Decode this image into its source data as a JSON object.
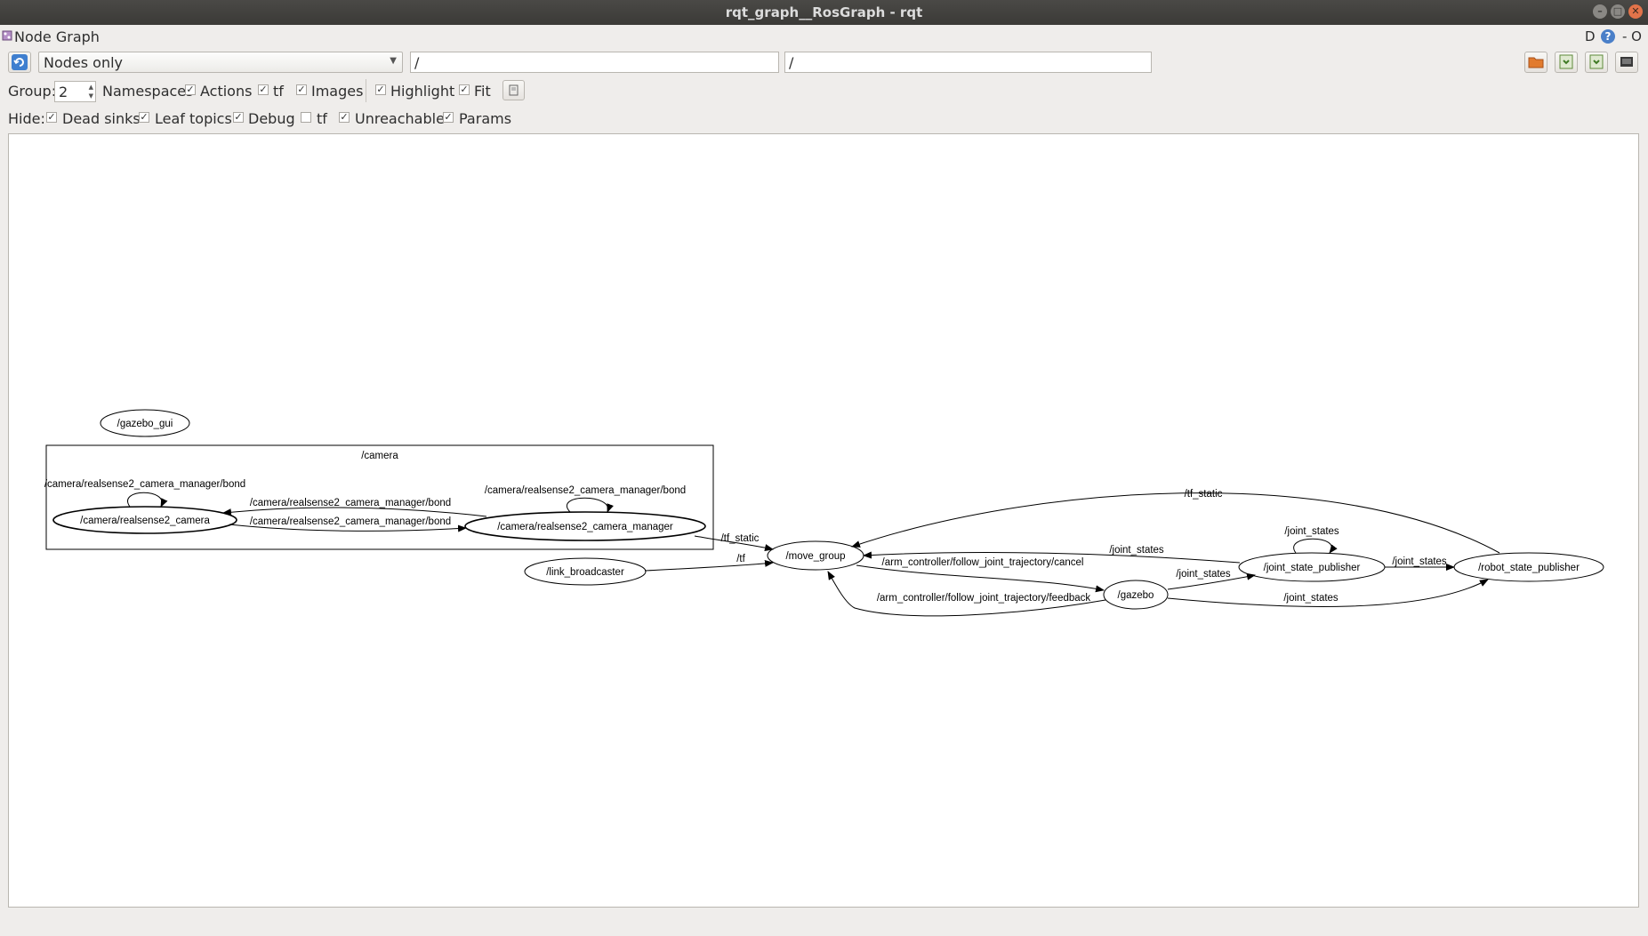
{
  "window": {
    "title": "rqt_graph__RosGraph - rqt"
  },
  "plugin": {
    "title": "Node Graph",
    "right_flags": "D",
    "right_flags2": "- O"
  },
  "toolbar": {
    "mode_value": "Nodes only",
    "node_filter_value": "/",
    "topic_filter_value": "/"
  },
  "options": {
    "group_label": "Group:",
    "group_value": "2",
    "namespaces": "Namespaces",
    "actions": "Actions",
    "tf": "tf",
    "images": "Images",
    "highlight": "Highlight",
    "fit": "Fit"
  },
  "hide": {
    "label": "Hide:",
    "dead_sinks": "Dead sinks",
    "leaf_topics": "Leaf topics",
    "debug": "Debug",
    "tf": "tf",
    "unreachable": "Unreachable",
    "params": "Params"
  },
  "checkbox_state": {
    "namespaces": true,
    "actions": true,
    "tf": true,
    "images": true,
    "highlight": true,
    "fit": true,
    "hide_dead_sinks": true,
    "hide_leaf_topics": true,
    "hide_debug": true,
    "hide_tf": false,
    "hide_unreachable": true,
    "hide_params": true
  },
  "graph": {
    "cluster_label": "/camera",
    "nodes": {
      "gazebo_gui": "/gazebo_gui",
      "realsense2_camera": "/camera/realsense2_camera",
      "realsense2_camera_manager": "/camera/realsense2_camera_manager",
      "link_broadcaster": "/link_broadcaster",
      "move_group": "/move_group",
      "gazebo": "/gazebo",
      "joint_state_publisher": "/joint_state_publisher",
      "robot_state_publisher": "/robot_state_publisher"
    },
    "edges": {
      "bond_self_camera": "/camera/realsense2_camera_manager/bond",
      "bond_self_manager": "/camera/realsense2_camera_manager/bond",
      "bond_to_camera": "/camera/realsense2_camera_manager/bond",
      "bond_to_manager": "/camera/realsense2_camera_manager/bond",
      "tf_static_manager": "/tf_static",
      "tf_link": "/tf",
      "tf_static_rsp": "/tf_static",
      "joint_states_jsp_mg": "/joint_states",
      "joint_states_jsp_self": "/joint_states",
      "cancel": "/arm_controller/follow_joint_trajectory/cancel",
      "joint_states_gazebo_jsp": "/joint_states",
      "joint_states_jsp_rsp": "/joint_states",
      "feedback": "/arm_controller/follow_joint_trajectory/feedback",
      "joint_states_gazebo_rsp": "/joint_states"
    }
  }
}
